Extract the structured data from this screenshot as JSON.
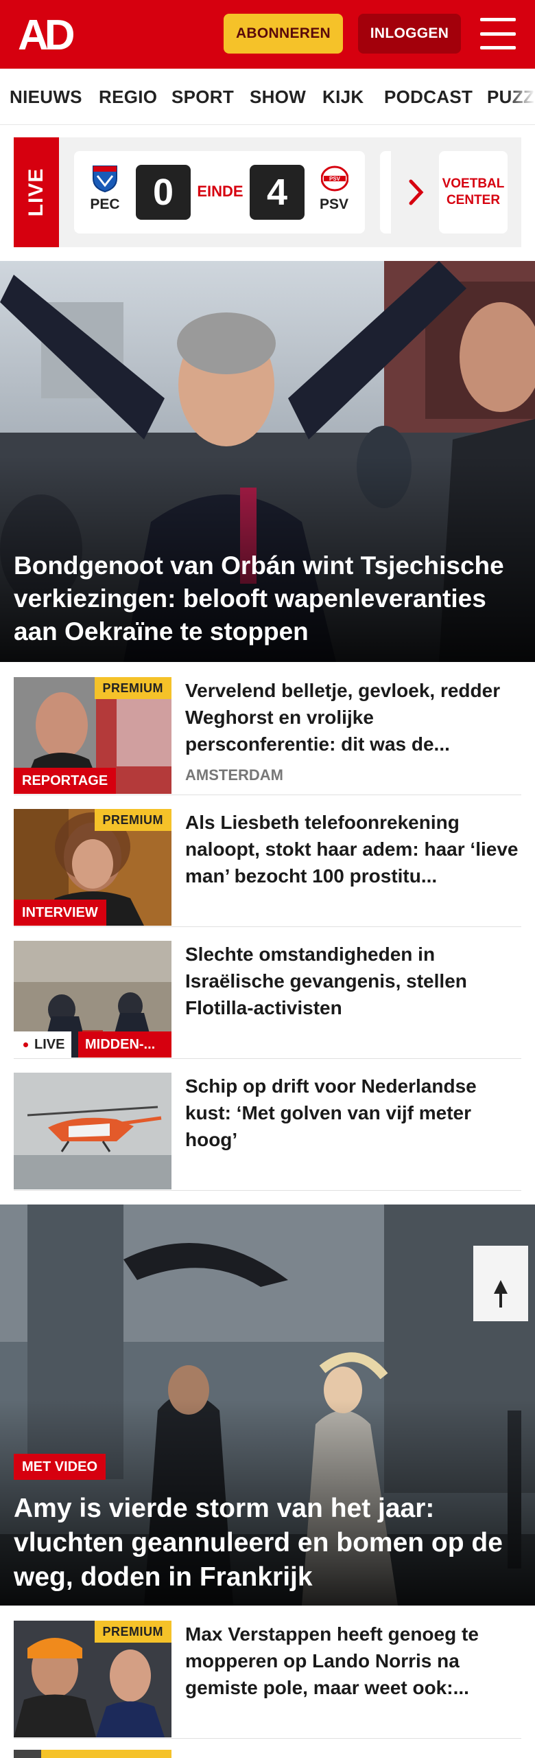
{
  "header": {
    "logo_text": "AD",
    "subscribe_label": "ABONNEREN",
    "login_label": "INLOGGEN",
    "menu_icon": "hamburger-icon",
    "brand_color": "#d6000f",
    "accent_color": "#f5c229"
  },
  "nav": {
    "items": [
      "NIEUWS",
      "REGIO",
      "SPORT",
      "SHOW",
      "KIJK",
      "PODCAST",
      "PUZZ"
    ]
  },
  "live": {
    "tag": "LIVE",
    "home_team": "PEC",
    "home_score": "0",
    "status": "EINDE",
    "away_score": "4",
    "away_team": "PSV",
    "more_label": "VOETBAL CENTER",
    "chevron_icon": "chevron-right-icon"
  },
  "hero": {
    "title": "Bondgenoot van Orbán wint Tsjechi­sche verkiezingen: belooft wapenleveranties aan Oekraïne te stoppen"
  },
  "articles": [
    {
      "title": "Vervelend belletje, gevloek, redder Weghorst en vrolijke persconferentie: dit was de...",
      "premium": "PREMIUM",
      "label": "REPORTAGE",
      "place": "AMSTERDAM"
    },
    {
      "title": "Als Liesbeth telefoonrekening naloopt, stokt haar adem: haar ‘lieve man’ bezocht 100 prostitu...",
      "premium": "PREMIUM",
      "label": "INTERVIEW"
    },
    {
      "title": "Slechte omstandigheden in Israëlische gevangenis, stellen Flotilla-activisten",
      "live": "LIVE",
      "label": "MIDDEN-..."
    },
    {
      "title": "Schip op drift voor Nederlandse kust: ‘Met golven van vijf meter hoog’"
    }
  ],
  "hero2": {
    "tag": "MET VIDEO",
    "title": "Amy is vierde storm van het jaar: vluchten geannuleerd en bomen op de weg, doden in Frankrijk"
  },
  "article5": {
    "title": "Max Verstappen heeft genoeg te mopperen op Lando Norris na gemiste pole, maar weet ook:...",
    "premium": "PREMIUM"
  }
}
